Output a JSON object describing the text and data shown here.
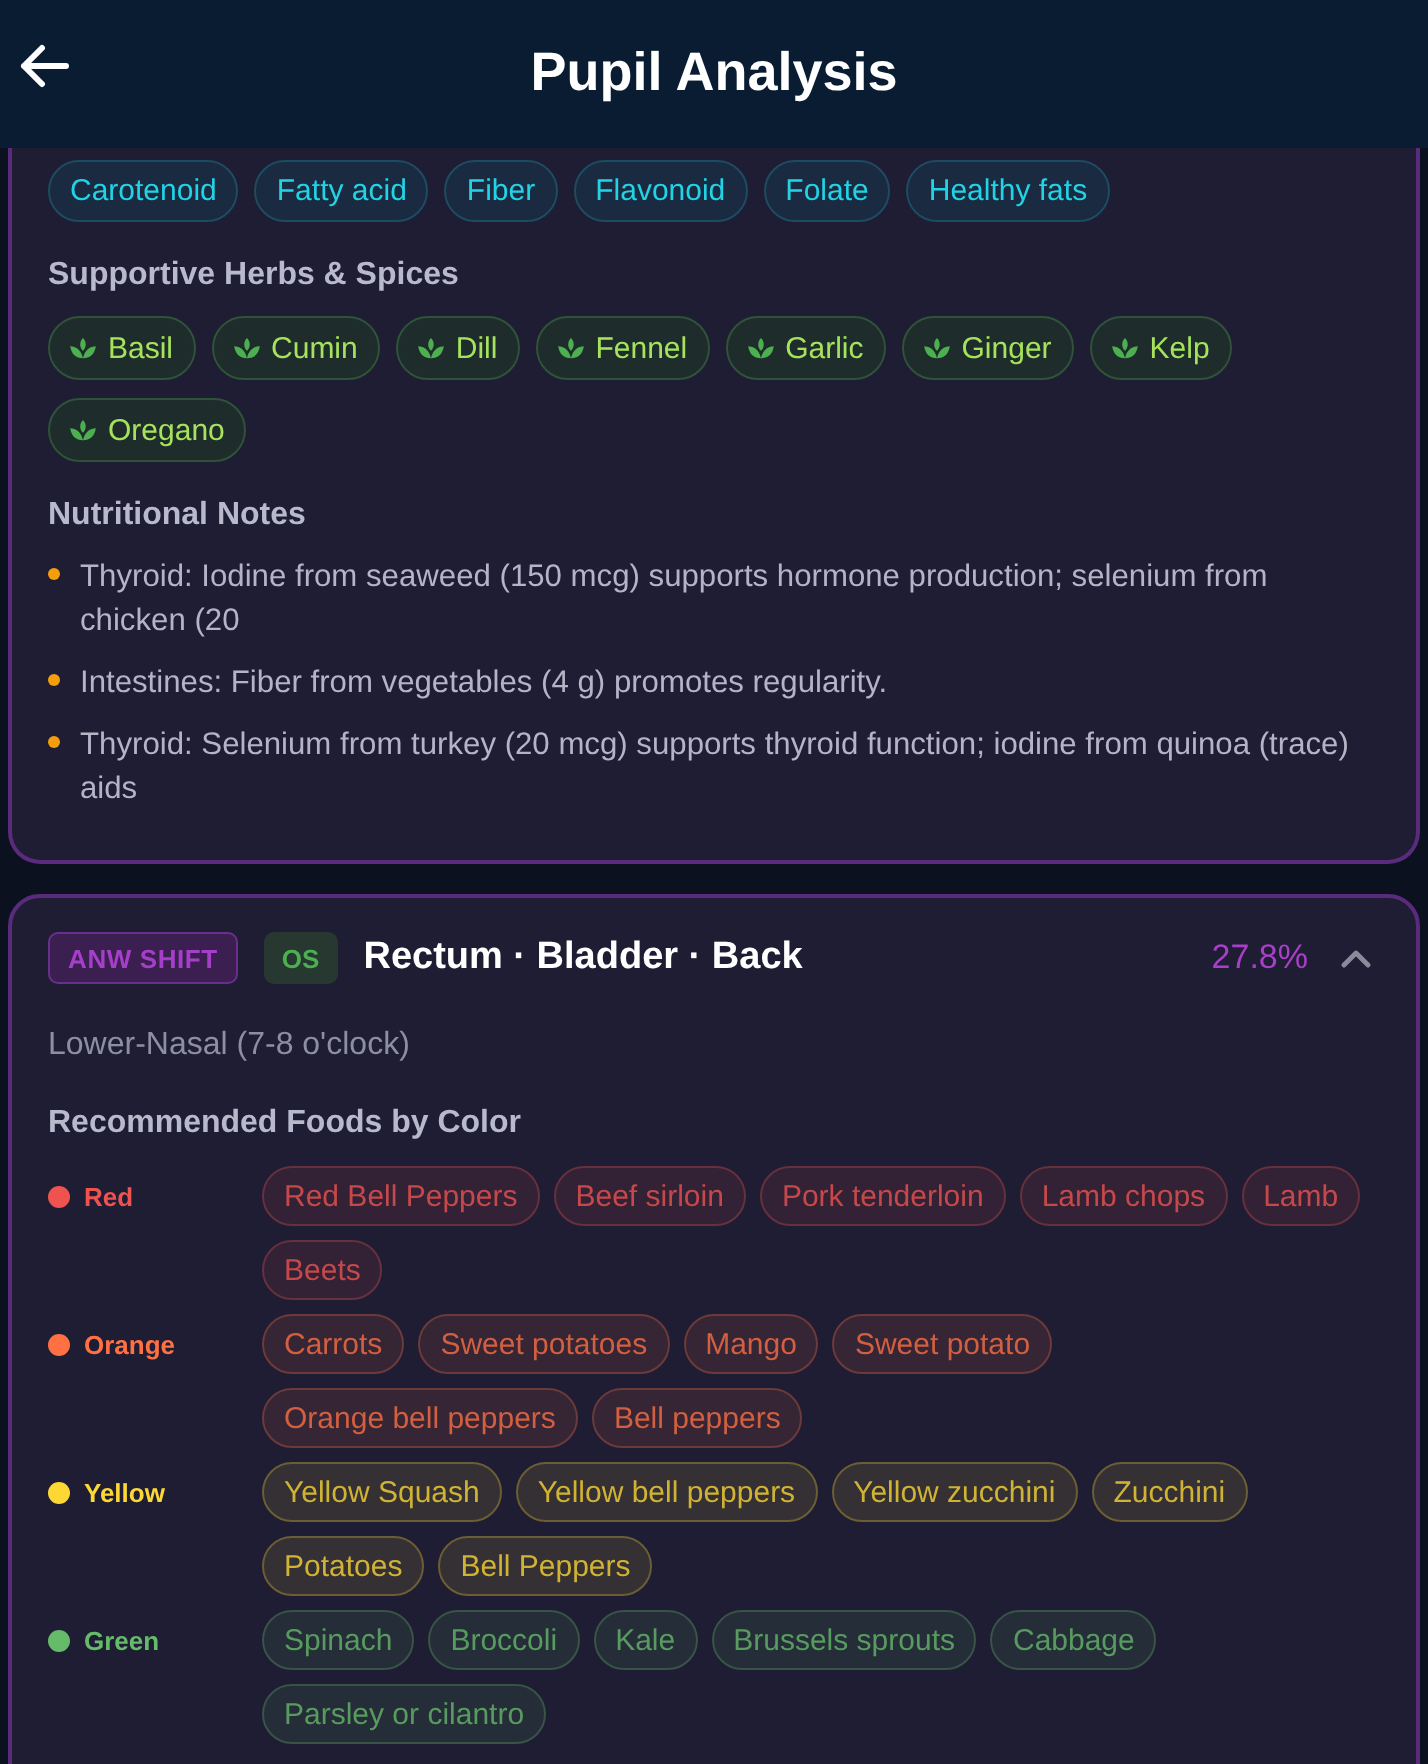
{
  "header": {
    "title": "Pupil Analysis"
  },
  "nutrition_card": {
    "nutrient_tags": [
      "Carotenoid",
      "Fatty acid",
      "Fiber",
      "Flavonoid",
      "Folate",
      "Healthy fats"
    ],
    "herbs": {
      "heading": "Supportive Herbs & Spices",
      "items": [
        "Basil",
        "Cumin",
        "Dill",
        "Fennel",
        "Garlic",
        "Ginger",
        "Kelp",
        "Oregano"
      ]
    },
    "notes": {
      "heading": "Nutritional Notes",
      "items": [
        "Thyroid: Iodine from seaweed (150 mcg) supports hormone production; selenium from chicken (20",
        "Intestines: Fiber from vegetables (4 g) promotes regularity.",
        "Thyroid: Selenium from turkey (20 mcg) supports thyroid function; iodine from quinoa (trace) aids"
      ]
    }
  },
  "zone_card": {
    "shift_badge": "ANW SHIFT",
    "eye_badge": "OS",
    "title": "Rectum · Bladder · Back",
    "percentage": "27.8%",
    "expanded": true,
    "zone": "Lower-Nasal (7-8 o'clock)",
    "foods_heading": "Recommended Foods by Color",
    "color_groups": [
      {
        "label": "Red",
        "color": "#ef5350",
        "foods": [
          "Red Bell Peppers",
          "Beef sirloin",
          "Pork tenderloin",
          "Lamb chops",
          "Lamb",
          "Beets"
        ]
      },
      {
        "label": "Orange",
        "color": "#ff7043",
        "foods": [
          "Carrots",
          "Sweet potatoes",
          "Mango",
          "Sweet potato",
          "Orange bell peppers",
          "Bell peppers"
        ]
      },
      {
        "label": "Yellow",
        "color": "#fdd835",
        "foods": [
          "Yellow Squash",
          "Yellow bell peppers",
          "Yellow zucchini",
          "Zucchini",
          "Potatoes",
          "Bell Peppers"
        ]
      },
      {
        "label": "Green",
        "color": "#66bb6a",
        "foods": [
          "Spinach",
          "Broccoli",
          "Kale",
          "Brussels sprouts",
          "Cabbage",
          "Parsley or cilantro"
        ]
      }
    ]
  }
}
